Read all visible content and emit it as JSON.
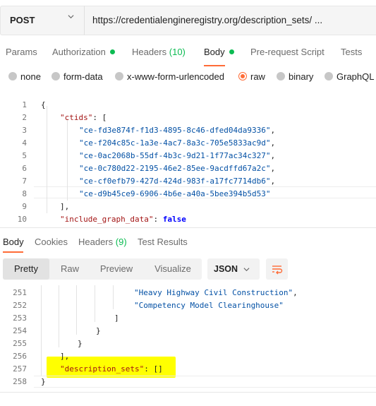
{
  "request": {
    "method": "POST",
    "url": "https://credentialengineregistry.org/description_sets/ ..."
  },
  "request_tabs": [
    {
      "label": "Params"
    },
    {
      "label": "Authorization"
    },
    {
      "label": "Headers",
      "count": "(10)"
    },
    {
      "label": "Body"
    },
    {
      "label": "Pre-request Script"
    },
    {
      "label": "Tests"
    }
  ],
  "body_types": [
    {
      "label": "none"
    },
    {
      "label": "form-data"
    },
    {
      "label": "x-www-form-urlencoded"
    },
    {
      "label": "raw",
      "selected": true
    },
    {
      "label": "binary"
    },
    {
      "label": "GraphQL"
    }
  ],
  "request_body": {
    "line_numbers": [
      "1",
      "2",
      "3",
      "4",
      "5",
      "6",
      "7",
      "8",
      "9",
      "10"
    ],
    "lines": [
      {
        "text": "{"
      },
      {
        "key": "\"ctids\"",
        "after": ": ["
      },
      {
        "str": "\"ce-fd3e874f-f1d3-4895-8c46-dfed04da9336\"",
        "after": ","
      },
      {
        "str": "\"ce-f204c85c-1a3e-4ac7-8a3c-705e5833ac9d\"",
        "after": ","
      },
      {
        "str": "\"ce-0ac2068b-55df-4b3c-9d21-1f77ac34c327\"",
        "after": ","
      },
      {
        "str": "\"ce-0c780d22-2195-46e2-85ee-9acdffd67a2c\"",
        "after": ","
      },
      {
        "str": "\"ce-cf0efb79-427d-424d-983f-a17fc7714db6\"",
        "after": ","
      },
      {
        "str": "\"ce-d9b45ce9-6906-4b6e-a40a-5bee394b5d53\"",
        "after": ""
      },
      {
        "text": "],"
      },
      {
        "key": "\"include_graph_data\"",
        "after": ": ",
        "kw": "false"
      }
    ]
  },
  "response_tabs": [
    {
      "label": "Body"
    },
    {
      "label": "Cookies"
    },
    {
      "label": "Headers",
      "count": "(9)"
    },
    {
      "label": "Test Results"
    }
  ],
  "format_buttons": [
    {
      "label": "Pretty"
    },
    {
      "label": "Raw"
    },
    {
      "label": "Preview"
    },
    {
      "label": "Visualize"
    }
  ],
  "format_select": "JSON",
  "response_body": {
    "line_numbers": [
      "251",
      "252",
      "253",
      "254",
      "255",
      "256",
      "257",
      "258"
    ],
    "lines": [
      {
        "str": "\"Heavy Highway Civil Construction\"",
        "after": ","
      },
      {
        "str": "\"Competency Model Clearinghouse\"",
        "after": ""
      },
      {
        "text": "]"
      },
      {
        "text": "}"
      },
      {
        "text": "}"
      },
      {
        "text": "],"
      },
      {
        "key": "\"description_sets\"",
        "after": ": []"
      },
      {
        "text": "}"
      }
    ]
  },
  "colors": {
    "accent": "#ff6c37",
    "status_dot": "#0cbb52",
    "highlight": "#ffff00"
  }
}
